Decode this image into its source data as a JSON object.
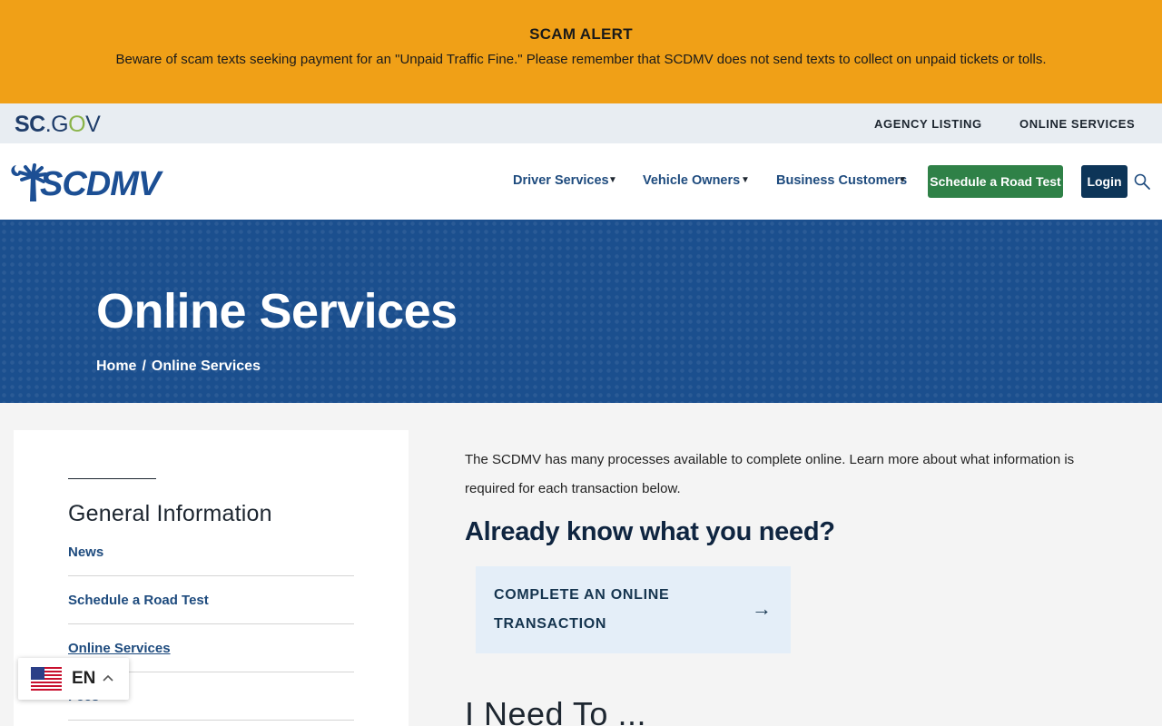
{
  "alert": {
    "title": "SCAM ALERT",
    "text": "Beware of scam texts seeking payment for an \"Unpaid Traffic Fine.\" Please remember that SCDMV does not send texts to collect on unpaid tickets or tolls."
  },
  "govbar": {
    "logo_sc": "SC",
    "logo_dot": ".G",
    "logo_o": "O",
    "logo_v": "V",
    "links": [
      "AGENCY LISTING",
      "ONLINE SERVICES"
    ]
  },
  "header": {
    "logo_text": "SCDMV",
    "nav": [
      "Driver Services",
      "Vehicle Owners",
      "Business Customers"
    ],
    "caret": "▼",
    "road_test_label": "Schedule a Road Test",
    "login_label": "Login"
  },
  "hero": {
    "title": "Online Services",
    "breadcrumb": [
      "Home",
      "Online Services"
    ],
    "breadcrumb_sep": "/"
  },
  "sidebar": {
    "heading": "General Information",
    "items": [
      "News",
      "Schedule a Road Test",
      "Online Services",
      "Fees"
    ],
    "active_index": 2
  },
  "main": {
    "intro": "The SCDMV has many processes available to complete online. Learn more about what information is required for each transaction below.",
    "heading": "Already know what you need?",
    "cta_label": "COMPLETE AN ONLINE TRANSACTION",
    "cta_arrow": "→",
    "next_heading": "I Need To ..."
  },
  "language": {
    "code": "EN",
    "chevron": "^"
  },
  "colors": {
    "alert_bg": "#f0a017",
    "brand_blue": "#1c4f94",
    "hero_bg": "#1b4f8e",
    "road_test_bg": "#2f8147",
    "login_bg": "#0d3558"
  }
}
